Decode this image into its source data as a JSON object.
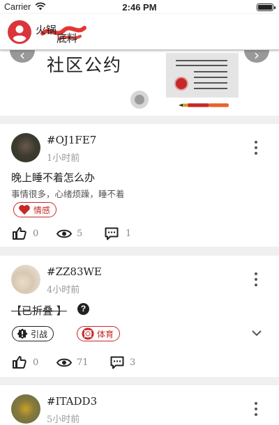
{
  "status_bar": {
    "carrier": "Carrier",
    "time": "2:46 PM"
  },
  "header": {
    "logo_line1": "火锅",
    "logo_line2": "底料"
  },
  "banner": {
    "title": "社区公约"
  },
  "posts": [
    {
      "user_id": "#OJ1FE7",
      "time_ago": "1小时前",
      "title": "晚上睡不着怎么办",
      "body": "事情很多，心绪烦躁，睡不着",
      "tags": [
        {
          "label": "情感",
          "icon": "heart-icon",
          "color": "#c62828"
        }
      ],
      "likes": "0",
      "views": "5",
      "comments": "1"
    },
    {
      "user_id": "#ZZ83WE",
      "time_ago": "4小时前",
      "folded_label": "【已折叠 】",
      "tags": [
        {
          "label": "引战",
          "icon": "alert-icon",
          "color": "#222222"
        },
        {
          "label": "体育",
          "icon": "lifebuoy-icon",
          "color": "#c62828"
        }
      ],
      "likes": "0",
      "views": "71",
      "comments": "3"
    },
    {
      "user_id": "#ITADD3",
      "time_ago": "5小时前"
    }
  ]
}
